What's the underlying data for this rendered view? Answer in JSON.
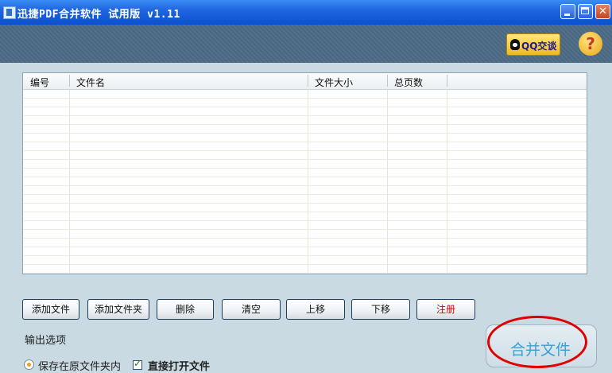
{
  "window": {
    "title": "迅捷PDF合并软件 试用版 v1.11"
  },
  "header": {
    "qq_label": "QQ交谈",
    "help_label": "?"
  },
  "table": {
    "columns": [
      "编号",
      "文件名",
      "文件大小",
      "总页数"
    ]
  },
  "toolbar": {
    "add_file": "添加文件",
    "add_folder": "添加文件夹",
    "delete": "删除",
    "clear": "清空",
    "move_up": "上移",
    "move_down": "下移",
    "register": "注册"
  },
  "output": {
    "section_label": "输出选项",
    "save_in_source": "保存在原文件夹内",
    "open_directly": "直接打开文件"
  },
  "merge": {
    "label": "合并文件"
  },
  "colors": {
    "titlebar": "#0a4fd1",
    "background": "#c9dae3",
    "register_text": "#d40000",
    "merge_text": "#3aa0d6",
    "highlight_ellipse": "#e00000"
  }
}
